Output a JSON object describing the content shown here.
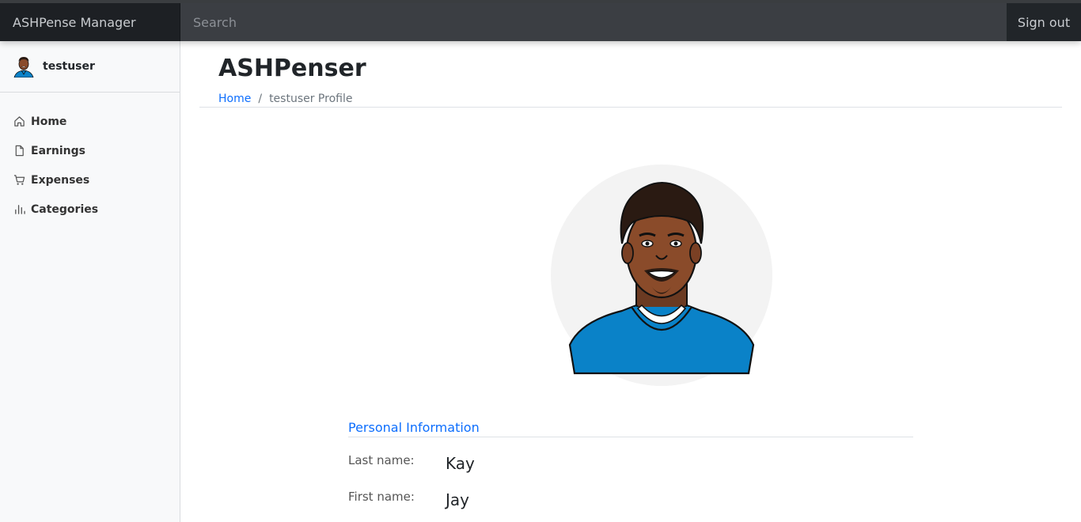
{
  "navbar": {
    "brand": "ASHPense Manager",
    "search_placeholder": "Search",
    "signout_label": "Sign out"
  },
  "sidebar": {
    "username": "testuser",
    "items": [
      {
        "label": "Home",
        "icon": "home-icon"
      },
      {
        "label": "Earnings",
        "icon": "file-icon"
      },
      {
        "label": "Expenses",
        "icon": "cart-icon"
      },
      {
        "label": "Categories",
        "icon": "bar-chart-icon"
      }
    ]
  },
  "main": {
    "title": "ASHPenser",
    "breadcrumb": {
      "home": "Home",
      "separator": "/",
      "current": "testuser Profile"
    },
    "section_title": "Personal Information",
    "fields": [
      {
        "label": "Last name:",
        "value": "Kay"
      },
      {
        "label": "First name:",
        "value": "Jay"
      }
    ]
  },
  "colors": {
    "navbar_bg": "#212529",
    "sidebar_bg": "#f8f9fa",
    "link": "#0d6efd",
    "jersey": "#0a82c8"
  }
}
